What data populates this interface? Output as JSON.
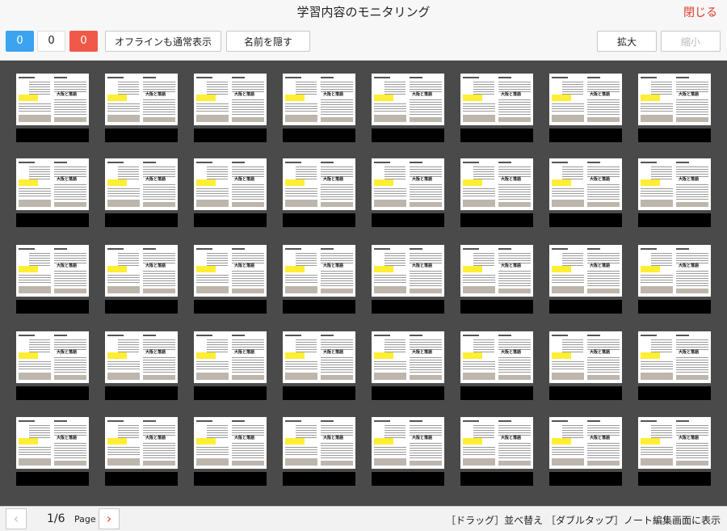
{
  "header": {
    "title": "学習内容のモニタリング",
    "close_label": "閉じる"
  },
  "toolbar": {
    "counts": {
      "blue": "0",
      "white": "0",
      "red": "0"
    },
    "offline_label": "オフラインも通常表示",
    "hide_names_label": "名前を隠す",
    "zoom_in_label": "拡大",
    "zoom_out_label": "縮小"
  },
  "thumb": {
    "heading": "大阪と落語"
  },
  "footer": {
    "prev_icon": "‹",
    "next_icon": "›",
    "page_indicator": "1/6",
    "page_label": "Page",
    "hint": "［ドラッグ］並べ替え ［ダブルタップ］ノート編集画面に表示"
  },
  "colors": {
    "accent_red": "#e03b2b",
    "count_blue": "#3ba3f0",
    "count_red": "#f0584a",
    "grid_bg": "#4a4a4a"
  }
}
